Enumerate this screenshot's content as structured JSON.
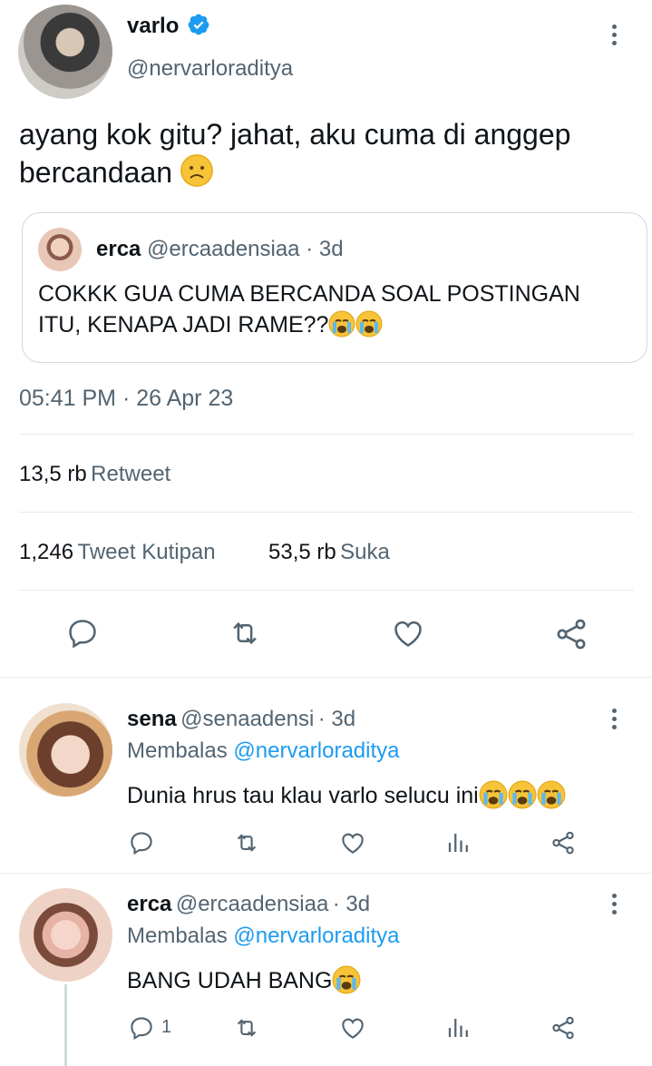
{
  "tweet": {
    "author_name": "varlo",
    "author_handle": "@nervarloraditya",
    "text": "ayang kok gitu? jahat, aku cuma di anggep",
    "text_line2": "bercandaan",
    "text_emoji": "sad-face-emoji",
    "timestamp": "05:41 PM · 26 Apr 23",
    "verified_color": "#1d9bf0"
  },
  "quoted": {
    "name": "erca",
    "handle": "@ercaadensiaa",
    "age": "· 3d",
    "line1": "COKKK GUA CUMA BERCANDA SOAL POSTINGAN",
    "line2": "ITU, KENAPA JADI RAME??",
    "emoji": "crying-face-emoji"
  },
  "stats": {
    "retweets_num": "13,5 rb",
    "retweets_lbl": "Retweet",
    "quotes_num": "1,246",
    "quotes_lbl": "Tweet Kutipan",
    "likes_num": "53,5 rb",
    "likes_lbl": "Suka"
  },
  "replies": [
    {
      "name": "sena",
      "handle": "@senaadensi",
      "age": "· 3d",
      "replying_prefix": "Membalas",
      "replying_to": "@nervarloraditya",
      "text": "Dunia hrus tau klau varlo selucu ini",
      "reply_count": ""
    },
    {
      "name": "erca",
      "handle": "@ercaadensiaa",
      "age": "· 3d",
      "replying_prefix": "Membalas",
      "replying_to": "@nervarloraditya",
      "text": "BANG UDAH BANG",
      "reply_count": "1"
    }
  ],
  "colors": {
    "link": "#1d9bf0",
    "secondary_text": "#536471",
    "icon": "#536471"
  }
}
